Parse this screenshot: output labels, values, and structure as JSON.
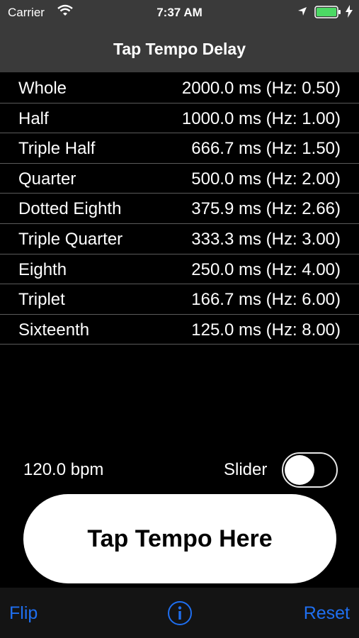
{
  "status": {
    "carrier": "Carrier",
    "time": "7:37 AM",
    "battery_color": "#4cd964"
  },
  "nav": {
    "title": "Tap Tempo Delay"
  },
  "rows": [
    {
      "label": "Whole",
      "value": "2000.0 ms (Hz: 0.50)"
    },
    {
      "label": "Half",
      "value": "1000.0 ms (Hz: 1.00)"
    },
    {
      "label": "Triple Half",
      "value": "666.7 ms (Hz: 1.50)"
    },
    {
      "label": "Quarter",
      "value": "500.0 ms (Hz: 2.00)"
    },
    {
      "label": "Dotted Eighth",
      "value": "375.9 ms (Hz: 2.66)"
    },
    {
      "label": "Triple Quarter",
      "value": "333.3 ms (Hz: 3.00)"
    },
    {
      "label": "Eighth",
      "value": "250.0 ms (Hz: 4.00)"
    },
    {
      "label": "Triplet",
      "value": "166.7 ms (Hz: 6.00)"
    },
    {
      "label": "Sixteenth",
      "value": "125.0 ms (Hz: 8.00)"
    }
  ],
  "controls": {
    "bpm": "120.0 bpm",
    "slider_label": "Slider",
    "slider_on": false,
    "tap_button": "Tap Tempo Here"
  },
  "toolbar": {
    "flip": "Flip",
    "reset": "Reset",
    "accent_color": "#1f6ff0"
  }
}
